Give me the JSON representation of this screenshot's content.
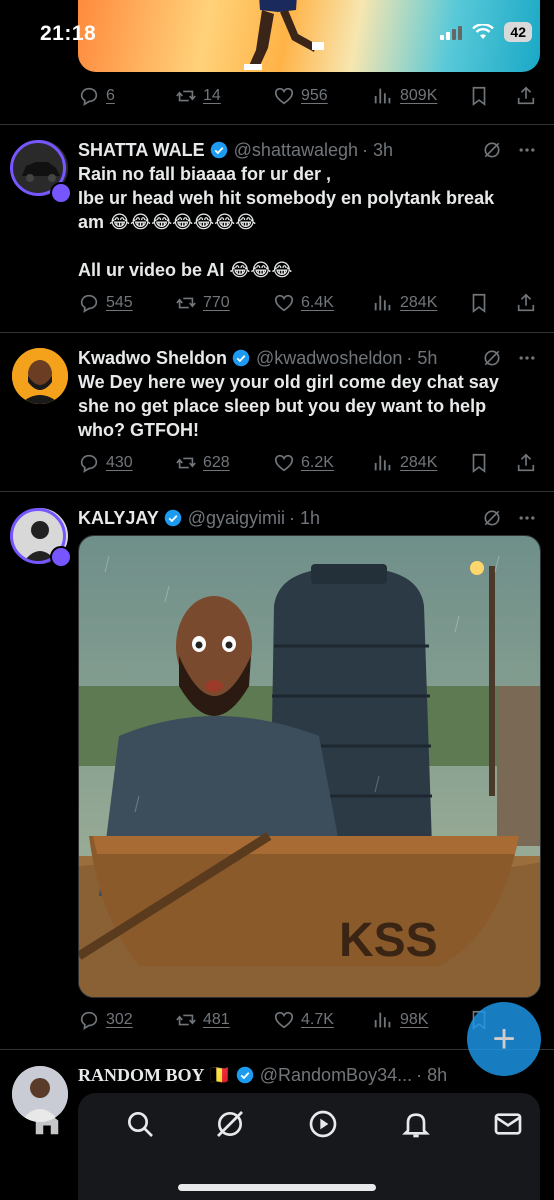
{
  "status_bar": {
    "time": "21:18",
    "battery": "42"
  },
  "tweets": [
    {
      "stats": {
        "replies": "6",
        "reposts": "14",
        "likes": "956",
        "views": "809K"
      }
    },
    {
      "name": "SHATTA WALE",
      "handle": "@shattawalegh",
      "time": "· 3h",
      "text_lines": [
        "Rain no fall biaaaa for ur der ,",
        "Ibe ur head weh hit somebody en polytank break",
        "am 😂😂😂😂😂😂😂",
        "",
        "All ur video be AI 😂😂😂"
      ],
      "stats": {
        "replies": "545",
        "reposts": "770",
        "likes": "6.4K",
        "views": "284K"
      }
    },
    {
      "name": "Kwadwo Sheldon",
      "handle": "@kwadwosheldon",
      "time": "· 5h",
      "text_lines": [
        "We Dey here wey your old girl come dey chat say",
        "she no get place sleep but you dey want to help",
        "who? GTFOH!"
      ],
      "stats": {
        "replies": "430",
        "reposts": "628",
        "likes": "6.2K",
        "views": "284K"
      }
    },
    {
      "name": "KALYJAY",
      "handle": "@gyaigyimii",
      "time": "· 1h",
      "image_text": "KSS",
      "stats": {
        "replies": "302",
        "reposts": "481",
        "likes": "4.7K",
        "views": "98K"
      }
    },
    {
      "name": "RANDOM BOY 🇧🇪",
      "handle": "@RandomBoy34...",
      "time": "· 8h"
    }
  ],
  "fab_label": "+",
  "colors": {
    "accent": "#1d9bf0",
    "verified": "#1d9bf0",
    "subscriber": "#7856ff",
    "muted": "#71767b"
  },
  "nav_icons": [
    "home-icon",
    "search-icon",
    "grok-icon",
    "video-icon",
    "notifications-icon",
    "messages-icon"
  ]
}
